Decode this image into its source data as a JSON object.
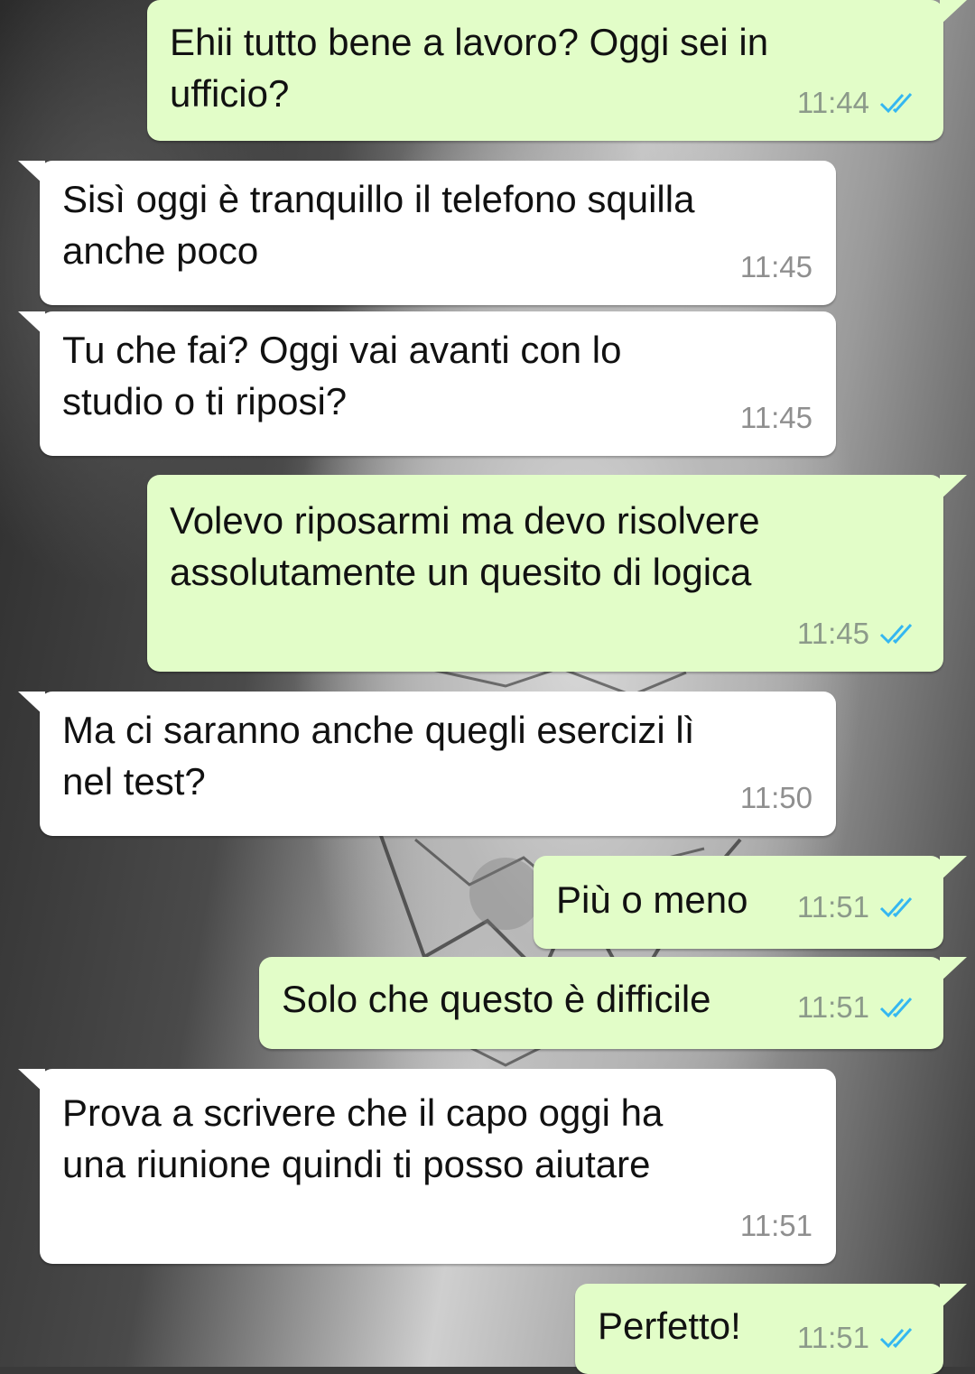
{
  "chat": {
    "messages": [
      {
        "direction": "out",
        "text": "Ehii tutto bene a lavoro? Oggi sei in\nufficio?",
        "time": "11:44",
        "status": "read"
      },
      {
        "direction": "in",
        "text": "Sisì oggi è tranquillo il telefono squilla\nanche poco",
        "time": "11:45"
      },
      {
        "direction": "in",
        "text": "Tu che fai? Oggi vai avanti con lo\nstudio o ti riposi?",
        "time": "11:45"
      },
      {
        "direction": "out",
        "text": "Volevo riposarmi ma devo risolvere\nassolutamente un quesito di logica",
        "time": "11:45",
        "status": "read"
      },
      {
        "direction": "in",
        "text": "Ma ci saranno anche quegli esercizi lì\nnel test?",
        "time": "11:50"
      },
      {
        "direction": "out",
        "text": "Più o meno",
        "time": "11:51",
        "status": "read"
      },
      {
        "direction": "out",
        "text": "Solo che questo è difficile",
        "time": "11:51",
        "status": "read"
      },
      {
        "direction": "in",
        "text": "Prova a scrivere che il capo oggi ha\nuna riunione quindi ti posso aiutare",
        "time": "11:51"
      },
      {
        "direction": "out",
        "text": "Perfetto!",
        "time": "11:51",
        "status": "read"
      }
    ]
  },
  "colors": {
    "outgoing_bubble": "#e2fdc8",
    "incoming_bubble": "#ffffff",
    "read_ticks": "#34b7f1"
  }
}
